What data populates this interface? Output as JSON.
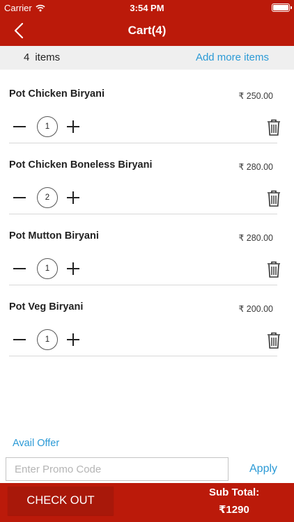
{
  "status_bar": {
    "carrier": "Carrier",
    "time": "3:54 PM"
  },
  "nav": {
    "title": "Cart(4)",
    "back_icon": "chevron-left-icon"
  },
  "summary": {
    "count": "4",
    "items_label": "items",
    "add_more": "Add more items"
  },
  "items": [
    {
      "name": "Pot Chicken Biryani",
      "price": "₹ 250.00",
      "qty": "1"
    },
    {
      "name": "Pot Chicken Boneless Biryani",
      "price": "₹ 280.00",
      "qty": "2"
    },
    {
      "name": "Pot Mutton Biryani",
      "price": "₹ 280.00",
      "qty": "1"
    },
    {
      "name": "Pot Veg Biryani",
      "price": "₹ 200.00",
      "qty": "1"
    }
  ],
  "offer": {
    "avail_label": "Avail Offer",
    "promo_placeholder": "Enter Promo Code",
    "promo_value": "",
    "apply_label": "Apply"
  },
  "footer": {
    "checkout_label": "CHECK OUT",
    "subtotal_label": "Sub Total:",
    "subtotal_value": "₹1290"
  },
  "colors": {
    "brand_red": "#bb1a0a",
    "checkout_red": "#a8180a",
    "link_blue": "#2b9ad6",
    "summary_bg": "#efefef"
  }
}
